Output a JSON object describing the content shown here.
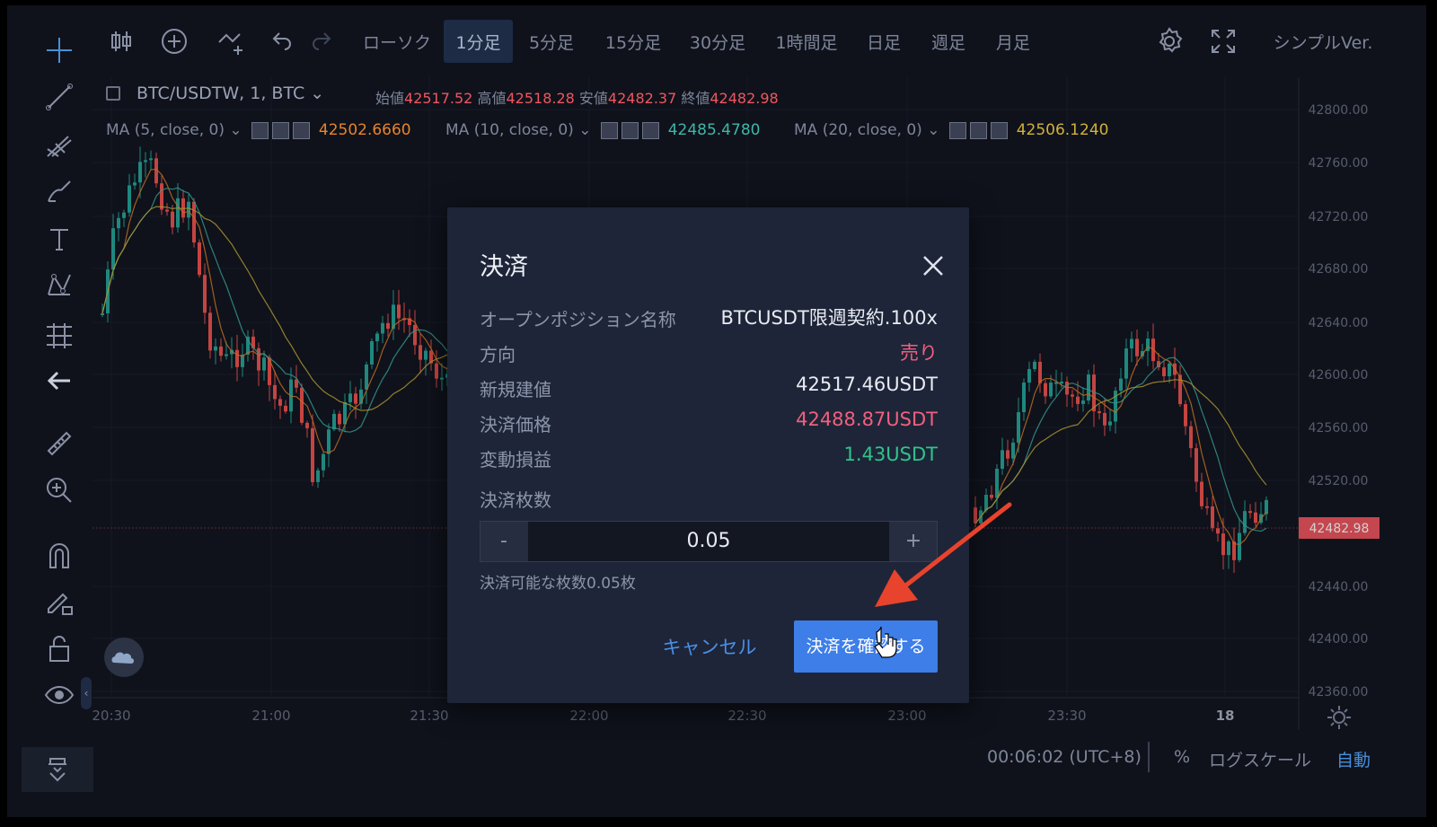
{
  "toolbar": {
    "chart_type": "ローソク",
    "timeframes": [
      "1分足",
      "5分足",
      "15分足",
      "30分足",
      "1時間足",
      "日足",
      "週足",
      "月足"
    ],
    "active_timeframe": "1分足",
    "simple_version": "シンプルVer."
  },
  "left_tools": [
    "crosshair-icon",
    "trend-line-icon",
    "pitchfork-icon",
    "brush-icon",
    "text-icon",
    "pattern-icon",
    "prediction-icon",
    "back-arrow-icon",
    "ruler-icon",
    "zoom-in-icon",
    "magnet-icon",
    "lock-drawing-icon",
    "lock-icon",
    "eye-icon",
    "trash-icon"
  ],
  "symbol": {
    "name": "BTC/USDTW, 1, BTC",
    "open_label": "始値",
    "open": "42517.52",
    "high_label": "高値",
    "high": "42518.28",
    "low_label": "安値",
    "low": "42482.37",
    "close_label": "終値",
    "close": "42482.98"
  },
  "indicators": [
    {
      "label": "MA (5, close, 0)",
      "value": "42502.6660",
      "color": "#e8832a"
    },
    {
      "label": "MA (10, close, 0)",
      "value": "42485.4780",
      "color": "#3fb6a8"
    },
    {
      "label": "MA (20, close, 0)",
      "value": "42506.1240",
      "color": "#d1b13a"
    }
  ],
  "chart_data": {
    "type": "candlestick",
    "y_ticks": [
      "42800.00",
      "42760.00",
      "42720.00",
      "42680.00",
      "42640.00",
      "42600.00",
      "42560.00",
      "42520.00",
      "42440.00",
      "42400.00",
      "42360.00"
    ],
    "x_ticks": [
      "20:30",
      "21:00",
      "21:30",
      "22:00",
      "22:30",
      "23:00",
      "23:30",
      "18"
    ],
    "last_price": "42482.98",
    "up_color": "#26a69a",
    "down_color": "#ef5350"
  },
  "bottom": {
    "time": "00:06:02 (UTC+8)",
    "percent": "%",
    "log_scale": "ログスケール",
    "auto": "自動"
  },
  "modal": {
    "title": "決済",
    "rows": [
      {
        "label": "オープンポジション名称",
        "value": "BTCUSDT限週契約.100x",
        "color": "#e8ebf2"
      },
      {
        "label": "方向",
        "value": "売り",
        "color": "#f0607e"
      },
      {
        "label": "新規建値",
        "value": "42517.46USDT",
        "color": "#e8ebf2"
      },
      {
        "label": "決済価格",
        "value": "42488.87USDT",
        "color": "#f0607e"
      },
      {
        "label": "変動損益",
        "value": "1.43USDT",
        "color": "#2fc48a"
      }
    ],
    "qty_label": "決済枚数",
    "qty_value": "0.05",
    "minus": "-",
    "plus": "+",
    "available": "決済可能な枚数0.05枚",
    "cancel": "キャンセル",
    "confirm": "決済を確認する"
  }
}
